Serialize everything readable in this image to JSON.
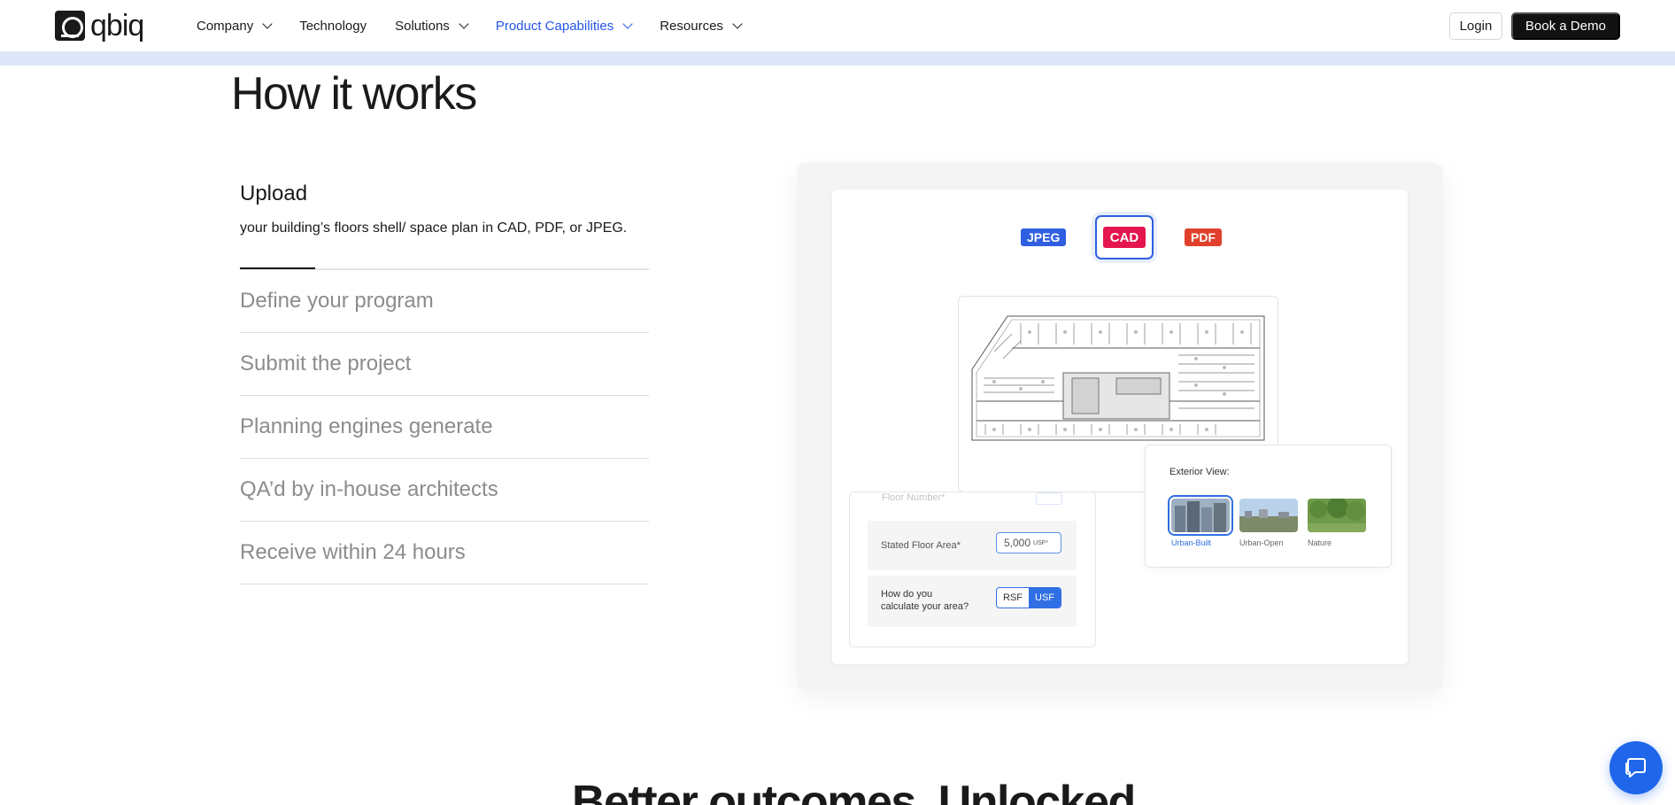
{
  "header": {
    "logo_text": "qbiq",
    "nav": [
      {
        "label": "Company",
        "has_dropdown": true
      },
      {
        "label": "Technology",
        "has_dropdown": false
      },
      {
        "label": "Solutions",
        "has_dropdown": true
      },
      {
        "label": "Product Capabilities",
        "has_dropdown": true,
        "active": true
      },
      {
        "label": "Resources",
        "has_dropdown": true
      }
    ],
    "login_label": "Login",
    "demo_label": "Book a Demo"
  },
  "section": {
    "title": "How it works",
    "active_step": {
      "title": "Upload",
      "description": "your building’s floors shell/ space plan in CAD, PDF, or JPEG."
    },
    "steps": [
      "Define your program",
      "Submit the project",
      "Planning engines generate",
      "QA’d by in-house architects",
      "Receive within 24 hours"
    ]
  },
  "illustration": {
    "badges": {
      "jpeg": "JPEG",
      "cad": "CAD",
      "pdf": "PDF"
    },
    "form": {
      "ghost_label": "Floor Number*",
      "area_label": "Stated Floor Area*",
      "area_value": "5,000",
      "area_unit": "USF*",
      "calc_label_1": "How do you",
      "calc_label_2": "calculate your area?",
      "toggle_left": "RSF",
      "toggle_right": "USF"
    },
    "exterior": {
      "title": "Exterior View:",
      "options": [
        "Urban-Built",
        "Urban-Open",
        "Nature"
      ]
    }
  },
  "next_section_title": "Better outcomes. Unlocked",
  "colors": {
    "accent": "#2456e8",
    "jpeg": "#2f5fe0",
    "cad": "#e5154d",
    "pdf": "#e0402c",
    "chat": "#1f66ea"
  }
}
